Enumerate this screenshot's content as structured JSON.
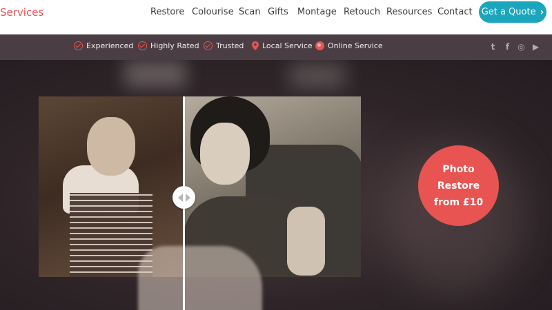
{
  "brand": {
    "text": "Services"
  },
  "nav": {
    "items": [
      {
        "label": "Restore"
      },
      {
        "label": "Colourise"
      },
      {
        "label": "Scan"
      },
      {
        "label": "Gifts"
      },
      {
        "label": "Montage"
      },
      {
        "label": "Retouch"
      },
      {
        "label": "Resources"
      },
      {
        "label": "Contact"
      }
    ],
    "cta": {
      "label": "Get a Quote",
      "icon": "chevron-right-icon"
    }
  },
  "trust": {
    "items": [
      {
        "label": "Experienced",
        "icon": "check-circle-icon"
      },
      {
        "label": "Highly Rated",
        "icon": "check-circle-icon"
      },
      {
        "label": "Trusted",
        "icon": "check-circle-icon"
      },
      {
        "label": "Local Service",
        "icon": "map-pin-icon"
      },
      {
        "label": "Online Service",
        "icon": "globe-icon"
      }
    ],
    "social": [
      {
        "name": "twitter-icon",
        "glyph": "t"
      },
      {
        "name": "facebook-icon",
        "glyph": "f"
      },
      {
        "name": "instagram-icon",
        "glyph": "◎"
      },
      {
        "name": "youtube-icon",
        "glyph": "▶"
      }
    ]
  },
  "hero": {
    "badge": {
      "line1": "Photo",
      "line2": "Restore",
      "line3": "from £10"
    }
  },
  "colors": {
    "accent": "#e85452",
    "cta": "#1aa6bd",
    "trustbar": "#4a3e44"
  }
}
